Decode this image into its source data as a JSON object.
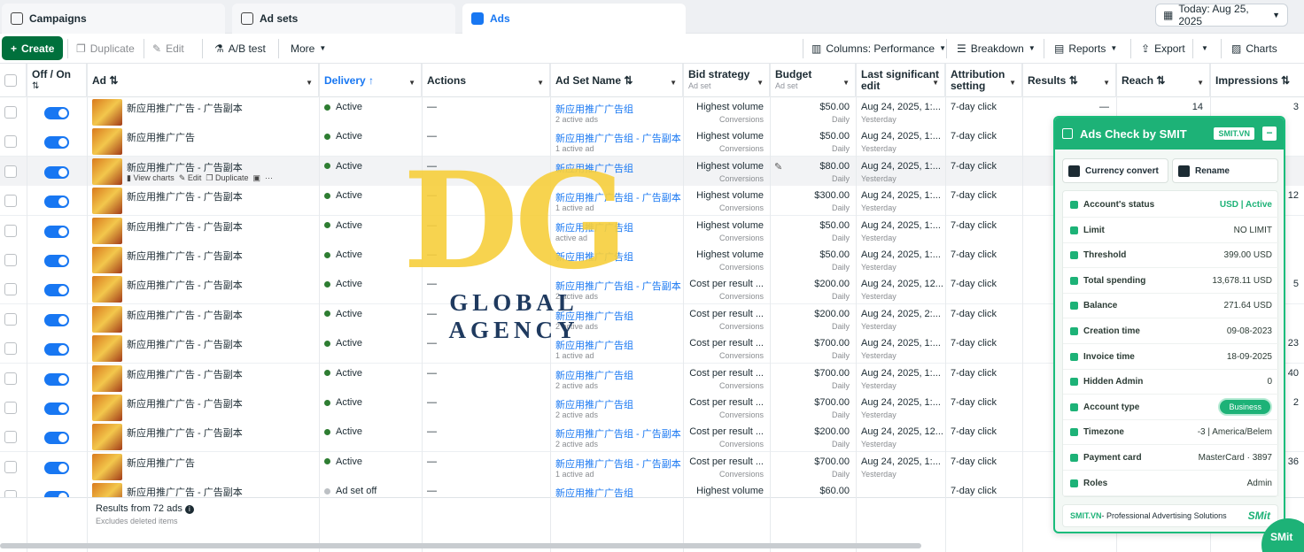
{
  "tabs": [
    {
      "label": "Campaigns",
      "icon": "folder-icon"
    },
    {
      "label": "Ad sets",
      "icon": "grid-icon"
    },
    {
      "label": "Ads",
      "icon": "ad-icon"
    }
  ],
  "date_button": "Today: Aug 25, 2025",
  "toolbar": {
    "create": "Create",
    "duplicate": "Duplicate",
    "edit": "Edit",
    "ab_test": "A/B test",
    "more": "More",
    "columns": "Columns: Performance",
    "breakdown": "Breakdown",
    "reports": "Reports",
    "export": "Export",
    "charts": "Charts"
  },
  "columns": {
    "offon": "Off / On",
    "ad": "Ad",
    "delivery": "Delivery",
    "actions": "Actions",
    "adset_name": "Ad Set Name",
    "bid_strategy": "Bid strategy",
    "bid_strategy_sub": "Ad set",
    "budget": "Budget",
    "budget_sub": "Ad set",
    "last_edit_1": "Last significant",
    "last_edit_2": "edit",
    "attribution_1": "Attribution",
    "attribution_2": "setting",
    "results": "Results",
    "reach": "Reach",
    "impressions": "Impressions"
  },
  "hover_actions": {
    "view_charts": "View charts",
    "edit": "Edit",
    "duplicate": "Duplicate"
  },
  "rows": [
    {
      "ad": "新应用推广广告 - 广告副本",
      "delivery": "Active",
      "actions": "—",
      "adset": "新应用推广广告组",
      "adset_sub": "2 active ads",
      "bid": "Highest volume",
      "bid_sub": "Conversions",
      "budget": "$50.00",
      "budget_sub": "Daily",
      "edit": "Aug 24, 2025, 1:...",
      "edit_sub": "Yesterday",
      "attr": "7-day click",
      "results": "—",
      "reach": "14"
    },
    {
      "ad": "新应用推广广告",
      "delivery": "Active",
      "actions": "—",
      "adset": "新应用推广广告组 - 广告副本",
      "adset_sub": "1 active ad",
      "bid": "Highest volume",
      "bid_sub": "Conversions",
      "budget": "$50.00",
      "budget_sub": "Daily",
      "edit": "Aug 24, 2025, 1:...",
      "edit_sub": "Yesterday",
      "attr": "7-day click",
      "results": "",
      "reach": ""
    },
    {
      "ad": "新应用推广广告 - 广告副本",
      "delivery": "Active",
      "actions": "—",
      "adset": "新应用推广广告组",
      "adset_sub": "",
      "bid": "Highest volume",
      "bid_sub": "Conversions",
      "budget": "$80.00",
      "budget_sub": "Daily",
      "edit": "Aug 24, 2025, 1:...",
      "edit_sub": "Yesterday",
      "attr": "7-day click",
      "results": "",
      "reach": ""
    },
    {
      "ad": "新应用推广广告 - 广告副本",
      "delivery": "Active",
      "actions": "—",
      "adset": "新应用推广广告组 - 广告副本",
      "adset_sub": "1 active ad",
      "bid": "Highest volume",
      "bid_sub": "Conversions",
      "budget": "$300.00",
      "budget_sub": "Daily",
      "edit": "Aug 24, 2025, 1:...",
      "edit_sub": "Yesterday",
      "attr": "7-day click",
      "results": "",
      "reach": ""
    },
    {
      "ad": "新应用推广广告 - 广告副本",
      "delivery": "Active",
      "actions": "—",
      "adset": "新应用推广广告组",
      "adset_sub": "active ad",
      "bid": "Highest volume",
      "bid_sub": "Conversions",
      "budget": "$50.00",
      "budget_sub": "Daily",
      "edit": "Aug 24, 2025, 1:...",
      "edit_sub": "Yesterday",
      "attr": "7-day click",
      "results": "",
      "reach": ""
    },
    {
      "ad": "新应用推广广告 - 广告副本",
      "delivery": "Active",
      "actions": "—",
      "adset": "新应用推广广告组",
      "adset_sub": "",
      "bid": "Highest volume",
      "bid_sub": "Conversions",
      "budget": "$50.00",
      "budget_sub": "Daily",
      "edit": "Aug 24, 2025, 1:...",
      "edit_sub": "Yesterday",
      "attr": "7-day click",
      "results": "",
      "reach": ""
    },
    {
      "ad": "新应用推广广告 - 广告副本",
      "delivery": "Active",
      "actions": "—",
      "adset": "新应用推广广告组 - 广告副本",
      "adset_sub": "2 active ads",
      "bid": "Cost per result ...",
      "bid_sub": "Conversions",
      "budget": "$200.00",
      "budget_sub": "Daily",
      "edit": "Aug 24, 2025, 12...",
      "edit_sub": "Yesterday",
      "attr": "7-day click",
      "results": "",
      "reach": ""
    },
    {
      "ad": "新应用推广广告 - 广告副本",
      "delivery": "Active",
      "actions": "—",
      "adset": "新应用推广广告组",
      "adset_sub": "2 active ads",
      "bid": "Cost per result ...",
      "bid_sub": "Conversions",
      "budget": "$200.00",
      "budget_sub": "Daily",
      "edit": "Aug 24, 2025, 2:...",
      "edit_sub": "Yesterday",
      "attr": "7-day click",
      "results": "",
      "reach": ""
    },
    {
      "ad": "新应用推广广告 - 广告副本",
      "delivery": "Active",
      "actions": "—",
      "adset": "新应用推广广告组",
      "adset_sub": "1 active ad",
      "bid": "Cost per result ...",
      "bid_sub": "Conversions",
      "budget": "$700.00",
      "budget_sub": "Daily",
      "edit": "Aug 24, 2025, 1:...",
      "edit_sub": "Yesterday",
      "attr": "7-day click",
      "results": "",
      "reach": ""
    },
    {
      "ad": "新应用推广广告 - 广告副本",
      "delivery": "Active",
      "actions": "—",
      "adset": "新应用推广广告组",
      "adset_sub": "2 active ads",
      "bid": "Cost per result ...",
      "bid_sub": "Conversions",
      "budget": "$700.00",
      "budget_sub": "Daily",
      "edit": "Aug 24, 2025, 1:...",
      "edit_sub": "Yesterday",
      "attr": "7-day click",
      "results": "",
      "reach": ""
    },
    {
      "ad": "新应用推广广告 - 广告副本",
      "delivery": "Active",
      "actions": "—",
      "adset": "新应用推广广告组",
      "adset_sub": "2 active ads",
      "bid": "Cost per result ...",
      "bid_sub": "Conversions",
      "budget": "$700.00",
      "budget_sub": "Daily",
      "edit": "Aug 24, 2025, 1:...",
      "edit_sub": "Yesterday",
      "attr": "7-day click",
      "results": "",
      "reach": ""
    },
    {
      "ad": "新应用推广广告 - 广告副本",
      "delivery": "Active",
      "actions": "—",
      "adset": "新应用推广广告组 - 广告副本",
      "adset_sub": "2 active ads",
      "bid": "Cost per result ...",
      "bid_sub": "Conversions",
      "budget": "$200.00",
      "budget_sub": "Daily",
      "edit": "Aug 24, 2025, 12...",
      "edit_sub": "Yesterday",
      "attr": "7-day click",
      "results": "",
      "reach": ""
    },
    {
      "ad": "新应用推广广告",
      "delivery": "Active",
      "actions": "—",
      "adset": "新应用推广广告组 - 广告副本",
      "adset_sub": "1 active ad",
      "bid": "Cost per result ...",
      "bid_sub": "Conversions",
      "budget": "$700.00",
      "budget_sub": "Daily",
      "edit": "Aug 24, 2025, 1:...",
      "edit_sub": "Yesterday",
      "attr": "7-day click",
      "results": "",
      "reach": ""
    },
    {
      "ad": "新应用推广广告 - 广告副本",
      "delivery": "Ad set off",
      "actions": "—",
      "adset": "新应用推广广告组",
      "adset_sub": "",
      "bid": "Highest volume",
      "bid_sub": "",
      "budget": "$60.00",
      "budget_sub": "",
      "edit": "",
      "edit_sub": "",
      "attr": "7-day click",
      "results": "",
      "reach": ""
    }
  ],
  "impressions_partial": [
    "3",
    "",
    "",
    "12",
    "",
    "",
    "5",
    "",
    "23",
    "40",
    "2",
    "",
    "36",
    ""
  ],
  "footer": {
    "results": "Results from 72 ads",
    "sub": "Excludes deleted items"
  },
  "watermark": {
    "big": "DG",
    "small": "GLOBAL AGENCY"
  },
  "panel": {
    "title": "Ads Check by SMIT",
    "badge": "SMIT.VN",
    "btn_currency": "Currency convert",
    "btn_rename": "Rename",
    "items": [
      {
        "k": "Account's status",
        "v": "USD | Active",
        "icon": "status-icon"
      },
      {
        "k": "Limit",
        "v": "NO LIMIT",
        "icon": "limit-icon"
      },
      {
        "k": "Threshold",
        "v": "399.00 USD",
        "icon": "threshold-icon"
      },
      {
        "k": "Total spending",
        "v": "13,678.11 USD",
        "icon": "spending-icon"
      },
      {
        "k": "Balance",
        "v": "271.64 USD",
        "icon": "balance-icon"
      },
      {
        "k": "Creation time",
        "v": "09-08-2023",
        "icon": "clock-icon"
      },
      {
        "k": "Invoice time",
        "v": "18-09-2025",
        "icon": "invoice-icon"
      },
      {
        "k": "Hidden Admin",
        "v": "0",
        "icon": "shield-icon"
      },
      {
        "k": "Account type",
        "v": "Business",
        "icon": "account-type-icon"
      },
      {
        "k": "Timezone",
        "v": "-3 | America/Belem",
        "icon": "timezone-icon"
      },
      {
        "k": "Payment card",
        "v": "MasterCard · 3897",
        "icon": "card-icon"
      },
      {
        "k": "Roles",
        "v": "Admin",
        "icon": "roles-icon"
      }
    ],
    "footer_brand": "SMIT.VN",
    "footer_text": " - Professional Advertising Solutions",
    "footer_logo": "SMit",
    "fab": "SMit"
  }
}
